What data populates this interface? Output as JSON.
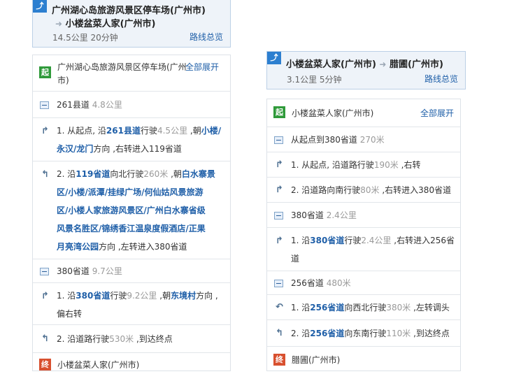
{
  "left": {
    "header": {
      "marker": "",
      "origin": "广州湖心岛旅游风景区停车场(广州市)",
      "destination": "小楼盆菜人家(广州市)",
      "distance_time": "14.5公里 20分钟",
      "overview": "路线总览"
    },
    "start": {
      "badge": "起",
      "name_line1": "广州湖心岛旅游风景区停车场(广州",
      "name_line2": "市)",
      "expand": "全部展开"
    },
    "segments": [
      {
        "road": "261县道",
        "dist": "4.8公里"
      },
      {
        "road": "380省道",
        "dist": "9.7公里"
      }
    ],
    "steps": [
      {
        "line1_pre": "1. 从起点, 沿",
        "road": "261县道",
        "line1_mid": "行驶",
        "dist": "4.5公里",
        "line1_post": " ,朝",
        "place1": "小楼/",
        "line2_place": "永汉/龙门",
        "line2_post": "方向 ,右转进入119省道"
      },
      {
        "l1_pre": "2. 沿",
        "road": "119省道",
        "l1_mid": "向北行驶",
        "dist": "260米",
        "l1_post": " ,朝",
        "l1_place": "白水寨景",
        "l2": "区/小楼/派潭/挂绿广场/何仙姑风景旅游",
        "l3": "区/小楼人家旅游风景区/广州白水寨省级",
        "l4": "风景名胜区/锦绣香江温泉度假酒店/正果",
        "l5_place": "月亮湾公园",
        "l5_post": "方向 ,左转进入380省道"
      },
      {
        "l1_pre": "1. 沿",
        "road": "380省道",
        "l1_mid": "行驶",
        "dist": "9.2公里",
        "l1_post": " ,朝",
        "place": "东境村",
        "l1_end": "方向 ,",
        "l2": "偏右转"
      },
      {
        "pre": "2. 沿道路行驶",
        "dist": "530米",
        "post": " ,到达终点"
      }
    ],
    "end": {
      "badge": "终",
      "name": "小楼盆菜人家(广州市)"
    }
  },
  "right": {
    "header": {
      "marker": "",
      "origin": "小楼盆菜人家(广州市)",
      "destination": "腊圃(广州市)",
      "distance_time": "3.1公里 5分钟",
      "overview": "路线总览"
    },
    "start": {
      "badge": "起",
      "name": "小楼盆菜人家(广州市)",
      "expand": "全部展开"
    },
    "segments": [
      {
        "road": "从起点到380省道",
        "dist": "270米"
      },
      {
        "road": "380省道",
        "dist": "2.4公里"
      },
      {
        "road": "256省道",
        "dist": "480米"
      }
    ],
    "steps": [
      {
        "pre": "1. 从起点, 沿道路行驶",
        "dist": "190米",
        "post": " ,右转"
      },
      {
        "pre": "2. 沿道路向南行驶",
        "dist": "80米",
        "post": " ,右转进入380省道"
      },
      {
        "pre": "1. 沿",
        "road": "380省道",
        "mid": "行驶",
        "dist": "2.4公里",
        "post": " ,右转进入256省",
        "l2": "道"
      },
      {
        "pre": "1. 沿",
        "road": "256省道",
        "mid": "向西北行驶",
        "dist": "380米",
        "post": " ,左转调头"
      },
      {
        "pre": "2. 沿",
        "road": "256省道",
        "mid": "向东南行驶",
        "dist": "110米",
        "post": " ,到达终点"
      }
    ],
    "end": {
      "badge": "终",
      "name": "腊圃(广州市)"
    }
  },
  "colors": {
    "accent": "#1f5fa8",
    "start_badge": "#2f9a3a",
    "end_badge": "#d8502f",
    "header_bg": "#eef3f9"
  },
  "icons": {
    "turn_right": "turn-right-icon",
    "turn_left": "turn-left-icon",
    "u_turn": "u-turn-icon",
    "collapse": "collapse-minus-icon",
    "route_marker": "route-marker-icon"
  }
}
